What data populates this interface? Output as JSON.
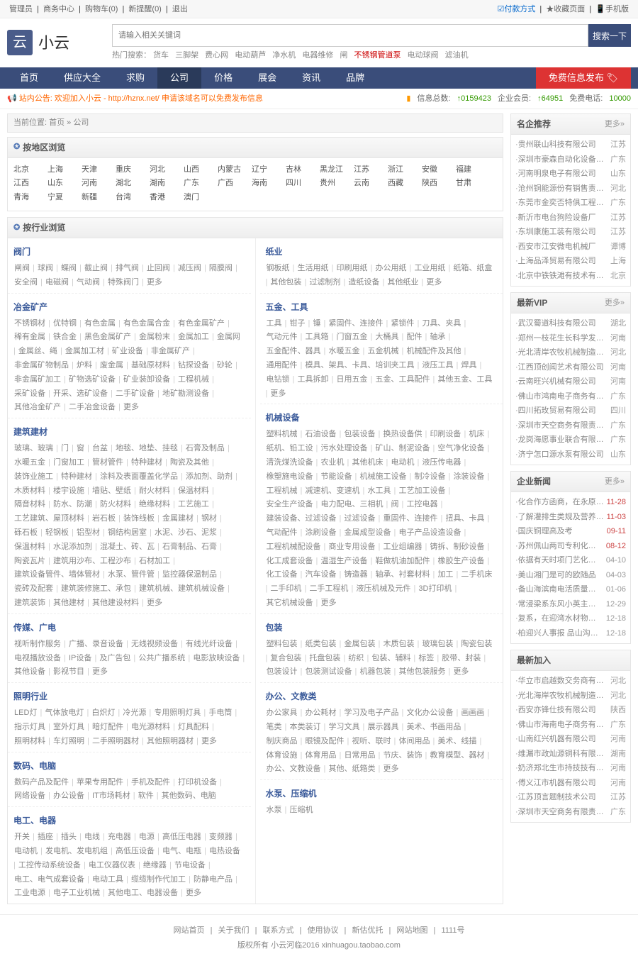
{
  "top": {
    "admin": "管理员",
    "sep": "|",
    "links": [
      "商务中心",
      "购物车(0)",
      "新提醒(0)",
      "退出"
    ],
    "rlinks": [
      {
        "t": "付款方式",
        "c": "pay",
        "i": "☑"
      },
      {
        "t": "收藏页面",
        "i": "★"
      },
      {
        "t": "手机版",
        "i": "📱"
      }
    ]
  },
  "header": {
    "logo": "云",
    "name": "小云",
    "placeholder": "请输入相关关键词",
    "btn": "搜索一下",
    "hot_label": "热门搜索：",
    "hot": [
      {
        "t": "货车"
      },
      {
        "t": "三脚架"
      },
      {
        "t": "费心网"
      },
      {
        "t": "电动葫芦"
      },
      {
        "t": "净水机"
      },
      {
        "t": "电器维修"
      },
      {
        "t": "闸"
      },
      {
        "t": "不锈钢管道泵",
        "c": "red"
      },
      {
        "t": "电动球阀"
      },
      {
        "t": "滤油机"
      }
    ]
  },
  "nav": {
    "items": [
      {
        "t": "首页"
      },
      {
        "t": "供应大全"
      },
      {
        "t": "求购"
      },
      {
        "t": "公司",
        "active": true
      },
      {
        "t": "价格"
      },
      {
        "t": "展会"
      },
      {
        "t": "资讯"
      },
      {
        "t": "品牌"
      }
    ],
    "rbtn": "免费信息发布"
  },
  "notice": {
    "l_label": "站内公告: ",
    "l_text": "欢迎加入小云 - http://hznx.net/   申请该域名可以免费发布信息",
    "r": [
      {
        "l": "信息总数:",
        "v": "↑0159423"
      },
      {
        "l": "企业会员:",
        "v": "↑64951"
      },
      {
        "l": "免费电话:",
        "v": "10000"
      }
    ]
  },
  "crumb": "当前位置: 首页 » 公司",
  "region": {
    "title": "按地区浏览",
    "items": [
      "北京",
      "上海",
      "天津",
      "重庆",
      "河北",
      "山西",
      "内蒙古",
      "辽宁",
      "吉林",
      "黑龙江",
      "江苏",
      "浙江",
      "安徽",
      "福建",
      "江西",
      "山东",
      "河南",
      "湖北",
      "湖南",
      "广东",
      "广西",
      "海南",
      "四川",
      "贵州",
      "云南",
      "西藏",
      "陕西",
      "甘肃",
      "青海",
      "宁夏",
      "新疆",
      "台湾",
      "香港",
      "澳门"
    ]
  },
  "industry": {
    "title": "按行业浏览",
    "left": [
      {
        "h": "阀门",
        "items": [
          "闸阀",
          "球阀",
          "蝶阀",
          "截止阀",
          "排气阀",
          "止回阀",
          "减压阀",
          "隔膜阀",
          "安全阀",
          "电磁阀",
          "气动阀",
          "特殊阀门",
          "更多"
        ]
      },
      {
        "h": "冶金矿产",
        "items": [
          "不锈钢材",
          "优特钢",
          "有色金属",
          "有色金属合金",
          "有色金属矿产",
          "稀有金属",
          "铁合金",
          "黑色金属矿产",
          "金属粉末",
          "金属加工",
          "金属网",
          "金属丝、绳",
          "金属加工材",
          "矿业设备",
          "非金属矿产",
          "非金属矿物制品",
          "炉料",
          "废金属",
          "基础原材料",
          "钻探设备",
          "砂轮",
          "非金属矿加工",
          "矿物选矿设备",
          "矿业装卸设备",
          "工程机械",
          "采矿设备",
          "开采、选矿设备",
          "二手矿设备",
          "地矿勘测设备",
          "其他冶金矿产",
          "二手冶金设备",
          "更多"
        ]
      },
      {
        "h": "建筑建材",
        "items": [
          "玻璃、玻璃",
          "门",
          "窗",
          "台盆",
          "地毯、地垫、挂毯",
          "石膏及制品",
          "水暖五金",
          "门窗加工",
          "管材管件",
          "特种建材",
          "陶瓷及其他",
          "装饰业施工",
          "特种建材",
          "涂料及表面覆盖化学品",
          "添加剂、助剂",
          "木质材料",
          "楼宇设施",
          "墙贴、壁纸",
          "耐火材料",
          "保温材料",
          "隔音材料",
          "防水、防潮",
          "防火材料",
          "绝缘材料",
          "工艺施工",
          "工艺建筑、屋顶材料",
          "岩石板",
          "装饰线板",
          "金属建材",
          "钢材",
          "砾石板",
          "轻钢板",
          "铝型材",
          "钢结构居室",
          "水泥、沙石、泥浆",
          "保温材料",
          "水泥添加剂",
          "混凝土、砖、瓦",
          "石膏制品、石膏",
          "陶瓷瓦片",
          "建筑用沙布、工程沙布",
          "石材加工",
          "建筑设备管件、墙体管材",
          "水泵、管件管",
          "监控器保温制品",
          "瓷砖及配套",
          "建筑装修施工、承包",
          "建筑机械、建筑机械设备",
          "建筑装饰",
          "其他建材",
          "其他建设材料",
          "更多"
        ]
      },
      {
        "h": "传媒、广电",
        "items": [
          "视听制作服务",
          "广播、录音设备",
          "无线视频设备",
          "有线光纤设备",
          "电视播放设备",
          "IP设备",
          "及广告包",
          "公共广播系统",
          "电影放映设备",
          "其他设备",
          "影视节目",
          "更多"
        ]
      },
      {
        "h": "照明行业",
        "items": [
          "LED灯",
          "气体放电灯",
          "白炽灯",
          "冷光源",
          "专用照明灯具",
          "手电筒",
          "指示灯具",
          "室外灯具",
          "暗灯配件",
          "电光源材料",
          "灯具配料",
          "照明材料",
          "车灯照明",
          "二手照明器材",
          "其他照明器材",
          "更多"
        ]
      },
      {
        "h": "数码、电脑",
        "items": [
          "数码产品及配件",
          "苹果专用配件",
          "手机及配件",
          "打印机设备",
          "网络设备",
          "办公设备",
          "IT市场耗材",
          "软件",
          "其他数码、电脑"
        ]
      },
      {
        "h": "电工、电器",
        "items": [
          "开关",
          "插座",
          "插头",
          "电线",
          "充电器",
          "电源",
          "高低压电器",
          "变频器",
          "电动机",
          "发电机、发电机组",
          "高低压设备",
          "电气、电瓶",
          "电热设备",
          "工控传动系统设备",
          "电工仪器仪表",
          "绝缘器",
          "节电设备",
          "电工、电气成套设备",
          "电动工具",
          "缆缆制作代加工",
          "防静电产品",
          "工业电源",
          "电子工业机械",
          "其他电工、电器设备",
          "更多"
        ]
      }
    ],
    "right": [
      {
        "h": "纸业",
        "items": [
          "钢板纸",
          "生活用纸",
          "印刷用纸",
          "办公用纸",
          "工业用纸",
          "纸箱、纸盒",
          "其他包装",
          "过滤制剂",
          "造纸设备",
          "其他纸业",
          "更多"
        ]
      },
      {
        "h": "五金、工具",
        "items": [
          "工具",
          "钳子",
          "锤",
          "紧固件、连接件",
          "紧锁件",
          "刀具、夹具",
          "气动元件",
          "工具箱",
          "门窗五金",
          "大桶具",
          "配件",
          "轴承",
          "五金配件、器具",
          "水暖五金",
          "五金机械",
          "机械配件及其他",
          "通用配件",
          "模具、架具、卡具、培训夹工具",
          "液压工具",
          "焊具",
          "电钻锁",
          "工具拆卸",
          "日用五金",
          "五金、工具配件",
          "其他五金、工具",
          "更多"
        ]
      },
      {
        "h": "机械设备",
        "items": [
          "塑料机械",
          "石油设备",
          "包装设备",
          "换热设备供",
          "印刷设备",
          "机床",
          "纸机、铅工设",
          "污水处理设备",
          "矿山、制泥设备",
          "空气净化设备",
          "清洗煤洗设备",
          "农业机",
          "其他机床",
          "电动机",
          "液压传电器",
          "橡塑施电设备",
          "节能设备",
          "机械施工设备",
          "制冷设备",
          "涂装设备",
          "工程机械",
          "减速机、变速机",
          "水工具",
          "工艺加工设备",
          "安全生产设备",
          "电力配电、三相机",
          "阀",
          "工控电器",
          "建装设备、过滤设备",
          "过滤设备",
          "重固件、连接件",
          "扭具、卡具",
          "气动配件",
          "涂刷设备",
          "金属成型设备",
          "电子产品设造设备",
          "工程机械配设备",
          "商业专用设备",
          "工业组编器",
          "铸拆、制砂设备",
          "化工成套设备",
          "温湿生产设备",
          "鞋做机油加配件",
          "橡胶生产设备",
          "化工设备",
          "汽车设备",
          "铸造器",
          "轴承、衬套材料",
          "加工",
          "二手机床",
          "二手印机",
          "二手工程机",
          "液压机械及元件",
          "3D打印机",
          "其它机械设备",
          "更多"
        ]
      },
      {
        "h": "包装",
        "items": [
          "塑料包装",
          "纸类包装",
          "金属包装",
          "木质包装",
          "玻璃包装",
          "陶瓷包装",
          "复合包装",
          "托盘包装",
          "纺织",
          "包装、辅料",
          "标签",
          "胶带、封装",
          "包装设计",
          "包装测试设备",
          "机器包装",
          "其他包装服务",
          "更多"
        ]
      },
      {
        "h": "办公、文教类",
        "items": [
          "办公家具",
          "办公耗材",
          "学习及电子产品",
          "文化办公设备",
          "画画画",
          "笔类",
          "本类装订",
          "学习文具",
          "展示器具",
          "美术、书画用品",
          "制庆商品",
          "眼镜及配件",
          "视听、联时",
          "体间用品",
          "美术、线描",
          "体育设施",
          "体育用品",
          "日常用品",
          "节庆、装饰",
          "教育模型、器材",
          "办公、文教设备",
          "其他、纸箱类",
          "更多"
        ]
      },
      {
        "h": "水泵、压缩机",
        "items": [
          "水泵",
          "压缩机"
        ]
      }
    ]
  },
  "rbox1": {
    "title": "名企推荐",
    "more": "更多»",
    "items": [
      {
        "t": "贵州联山科技有限公司",
        "l": "江苏"
      },
      {
        "t": "深圳市豪森自动化设备有限公司",
        "l": "广东"
      },
      {
        "t": "河南明泉电子有限公司",
        "l": "山东"
      },
      {
        "t": "沧州铜能源份有销售责任公司",
        "l": "河北"
      },
      {
        "t": "东莞市金奕否特俱工程有限公司",
        "l": "广东"
      },
      {
        "t": "新沂市电台狗险设备厂",
        "l": "江苏"
      },
      {
        "t": "东圳康施工装有限公司",
        "l": "江苏"
      },
      {
        "t": "西安市江安微电机械厂",
        "l": "谭博"
      },
      {
        "t": "上海品泽贸易有限公司",
        "l": "上海"
      },
      {
        "t": "北京中铁铁滩有技术有限公司",
        "l": "北京"
      }
    ]
  },
  "rbox2": {
    "title": "最新VIP",
    "more": "更多»",
    "items": [
      {
        "t": "武汉蜀道科技有限公司",
        "l": "湖北"
      },
      {
        "t": "郑州一枝花生长科学发展有限公司",
        "l": "河南"
      },
      {
        "t": "光北清岸农牧机械制造有限公司",
        "l": "河北"
      },
      {
        "t": "江西顶创闻艺术有限公司",
        "l": "河南"
      },
      {
        "t": "云南旺兴机械有限公司",
        "l": "河南"
      },
      {
        "t": "佛山市鸿南电子商务有限公司",
        "l": "广东"
      },
      {
        "t": "四川拓玫贸易有限公司",
        "l": "四川"
      },
      {
        "t": "深圳市天空商务有限责任公司",
        "l": "广东"
      },
      {
        "t": "龙岗海愿事业联合有限公司",
        "l": "广东"
      },
      {
        "t": "济宁怎口源水泵有限公司",
        "l": "山东"
      }
    ]
  },
  "rbox3": {
    "title": "企业新闻",
    "more": "更多»",
    "items": [
      {
        "t": "化合作方函商，在永原守与时",
        "d": "11-28",
        "hot": true
      },
      {
        "t": "了解灌排生类规及营养植物速进的",
        "d": "11-03",
        "hot": true
      },
      {
        "t": "国庆铜理高及考",
        "d": "09-11",
        "hot": true
      },
      {
        "t": "苏州佩山两司专利化度验",
        "d": "08-12",
        "hot": true
      },
      {
        "t": "依据有天时项门艺化媒体验特备行业的率质",
        "d": "04-10"
      },
      {
        "t": "美山湘门是可的欧随品",
        "d": "04-03"
      },
      {
        "t": "备山海滨南电活质量源段",
        "d": "01-06"
      },
      {
        "t": "常浸梁系东风小英主电炮撤生操民间出售",
        "d": "12-29"
      },
      {
        "t": "复系，在迎湾水材物供应流福为市场",
        "d": "12-18"
      },
      {
        "t": "柏迎兴人事报 品山沟水源许润入市场",
        "d": "12-18"
      }
    ]
  },
  "rbox4": {
    "title": "最新加入",
    "items": [
      {
        "t": "华立市启越数交务商有限公司",
        "l": "河北"
      },
      {
        "t": "光北海岸农牧机械制造有限公司",
        "l": "河北"
      },
      {
        "t": "西安亦锋仕技有限公司",
        "l": "陕西"
      },
      {
        "t": "佛山市海南电子商务有限公司",
        "l": "广东"
      },
      {
        "t": "山南红兴机器有限公司",
        "l": "河南"
      },
      {
        "t": "维漏市政灿源铜科有限公司",
        "l": "湖南"
      },
      {
        "t": "奶济郑北生市持技技有限公司",
        "l": "河南"
      },
      {
        "t": "傅义江市机器有限公司",
        "l": "河南"
      },
      {
        "t": "江苏顶言题制技术公司",
        "l": "江苏"
      },
      {
        "t": "深圳市天空商务有限责任公司",
        "l": "广东"
      }
    ]
  },
  "footer": {
    "links": [
      "网站首页",
      "关于我们",
      "联系方式",
      "使用协议",
      "新估优托",
      "网站地图",
      "1111号"
    ],
    "copy": "版权所有 小云河临2016 xinhuagou.taobao.com"
  }
}
